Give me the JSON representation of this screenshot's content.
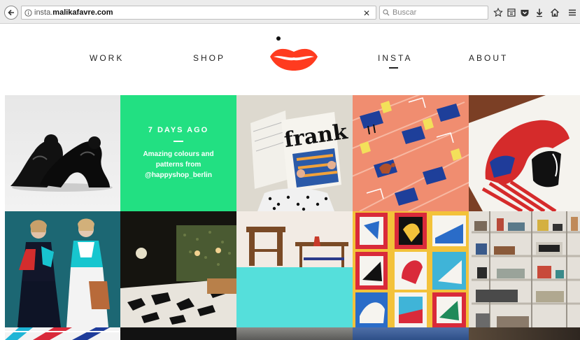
{
  "browser": {
    "url_prefix": "insta.",
    "url_domain": "malikafavre.com",
    "search_placeholder": "Buscar",
    "icons": [
      "back-arrow-icon",
      "info-icon",
      "clear-x-icon",
      "search-icon",
      "star-icon",
      "reading-list-icon",
      "pocket-icon",
      "download-icon",
      "home-icon",
      "menu-icon"
    ]
  },
  "site": {
    "nav": {
      "work": "WORK",
      "shop": "SHOP",
      "insta": "INSTA",
      "about": "ABOUT",
      "active": "INSTA"
    },
    "logo_color": "#ff3b1f"
  },
  "feature_post": {
    "date": "7 DAYS AGO",
    "caption": "Amazing colours and patterns from @happyshop_berlin",
    "color": "#22e082"
  }
}
